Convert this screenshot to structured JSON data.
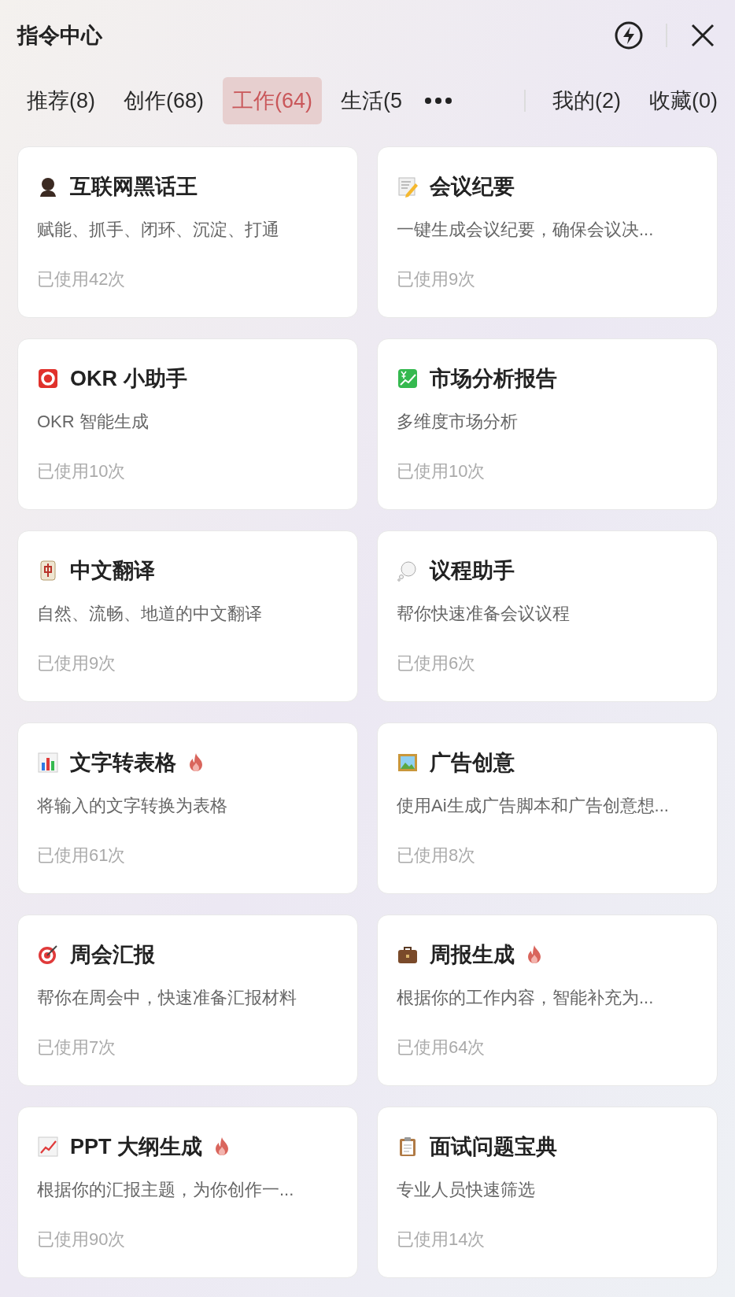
{
  "header": {
    "title": "指令中心"
  },
  "tabs": [
    {
      "label": "推荐(8)",
      "selected": false
    },
    {
      "label": "创作(68)",
      "selected": false
    },
    {
      "label": "工作(64)",
      "selected": true
    },
    {
      "label": "生活(5",
      "selected": false
    }
  ],
  "side_tabs": [
    {
      "label": "我的(2)",
      "selected": false
    },
    {
      "label": "收藏(0)",
      "selected": false
    }
  ],
  "cards": [
    {
      "title": "互联网黑话王",
      "description": "赋能、抓手、闭环、沉淀、打通",
      "usage": "已使用42次",
      "hot": false
    },
    {
      "title": "会议纪要",
      "description": "一键生成会议纪要，确保会议决...",
      "usage": "已使用9次",
      "hot": false
    },
    {
      "title": "OKR 小助手",
      "description": "OKR 智能生成",
      "usage": "已使用10次",
      "hot": false
    },
    {
      "title": "市场分析报告",
      "description": "多维度市场分析",
      "usage": "已使用10次",
      "hot": false
    },
    {
      "title": "中文翻译",
      "description": "自然、流畅、地道的中文翻译",
      "usage": "已使用9次",
      "hot": false
    },
    {
      "title": "议程助手",
      "description": "帮你快速准备会议议程",
      "usage": "已使用6次",
      "hot": false
    },
    {
      "title": "文字转表格",
      "description": "将输入的文字转换为表格",
      "usage": "已使用61次",
      "hot": true
    },
    {
      "title": "广告创意",
      "description": "使用Ai生成广告脚本和广告创意想...",
      "usage": "已使用8次",
      "hot": false
    },
    {
      "title": "周会汇报",
      "description": "帮你在周会中，快速准备汇报材料",
      "usage": "已使用7次",
      "hot": false
    },
    {
      "title": "周报生成",
      "description": "根据你的工作内容，智能补充为...",
      "usage": "已使用64次",
      "hot": true
    },
    {
      "title": "PPT 大纲生成",
      "description": "根据你的汇报主题，为你创作一...",
      "usage": "已使用90次",
      "hot": true
    },
    {
      "title": "面试问题宝典",
      "description": "专业人员快速筛选",
      "usage": "已使用14次",
      "hot": false
    }
  ]
}
